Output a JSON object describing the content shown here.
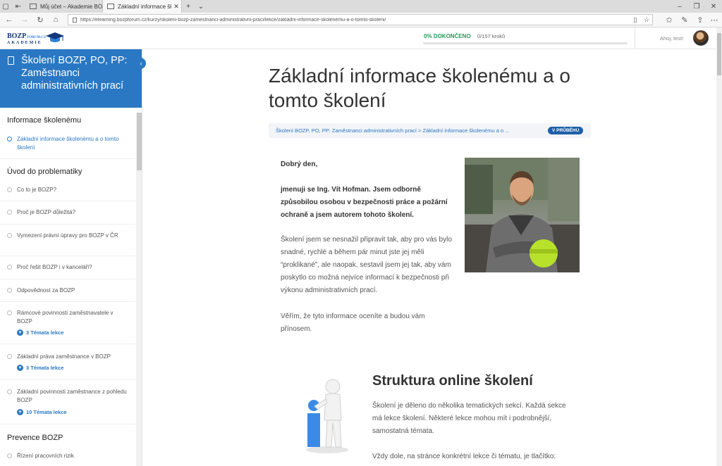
{
  "browser": {
    "tabs": [
      {
        "title": "Můj účet – Akademie BOZP",
        "active": false
      },
      {
        "title": "Základní informace škol",
        "active": true
      }
    ],
    "url": "https://elearning.bozpforum.cz/kurzy/skoleni-bozp-zamestnanci-administrativni-praci/lekce/zakladni-informace-skolenemu-a-o-tomto-skoleni/"
  },
  "header": {
    "logo_top": "BOZP",
    "logo_top_small": "FORUM.CZ",
    "logo_bottom": "AKADEMIE",
    "progress_label": "0% DOKONČENO",
    "progress_steps": "0/157 kroků",
    "progress_fraction": 0,
    "greeting": "Ahoj, test!"
  },
  "sidebar": {
    "course_title": "Školení BOZP, PO, PP: Zaměstnanci administrativních prací",
    "sections": [
      {
        "title": "Informace školenému"
      },
      {
        "title": "Úvod do problematiky"
      },
      {
        "title": "Prevence BOZP"
      }
    ],
    "items": [
      {
        "label": "Základní informace školenému a o tomto školení"
      },
      {
        "label": "Co to je BOZP?"
      },
      {
        "label": "Proč je BOZP důležitá?"
      },
      {
        "label": "Vymezení právní úpravy pro BOZP v ČR"
      },
      {
        "label": "Proč řešit BOZP i v kanceláři?"
      },
      {
        "label": "Odpovědnost za BOZP"
      },
      {
        "label": "Rámcové povinnosti zaměstnavatele v BOZP",
        "sub": "3 Témata lekce"
      },
      {
        "label": "Základní práva zaměstnance v BOZP",
        "sub": "3 Témata lekce"
      },
      {
        "label": "Základní povinnosti zaměstnance z pohledu BOZP",
        "sub": "10 Témata lekce"
      },
      {
        "label": "Řízení pracovních rizik"
      }
    ]
  },
  "main": {
    "title": "Základní informace školenému a o tomto školení",
    "breadcrumb": "Školení BOZP, PO, PP: Zaměstnanci administrativních prací > Základní informace školenému a o ...",
    "status_badge": "V PRŮBĚHU",
    "greeting": "Dobrý den,",
    "intro_bold": "jmenuji se Ing. Vít Hofman. Jsem odborně způsobilou osobou v bezpečnosti práce a požární ochraně a jsem autorem tohoto školení.",
    "para1": "Školení jsem se nesnažil připravit tak, aby pro vás bylo snadné, rychlé a během pár minut jste jej měli “proklikané”, ale naopak, sestavil jsem jej tak, aby vám poskytlo co možná nejvíce informací k bezpečnosti při výkonu administrativních prací.",
    "para2": "Věřím, že tyto informace oceníte a budou vám přínosem.",
    "section2_title": "Struktura online školení",
    "section2_para1": "Školení je děleno do několika tematických sekcí. Každá sekce má lekce školení. Některé lekce mohou mít i podrobnější, samostatná témata.",
    "section2_para2": "Vždy dole, na stránce konkrétní lekce či tématu, je tlačítko:"
  },
  "colors": {
    "brand_blue": "#2a78c3",
    "progress_green": "#1e9e5a",
    "badge_blue": "#1f5fa8"
  }
}
